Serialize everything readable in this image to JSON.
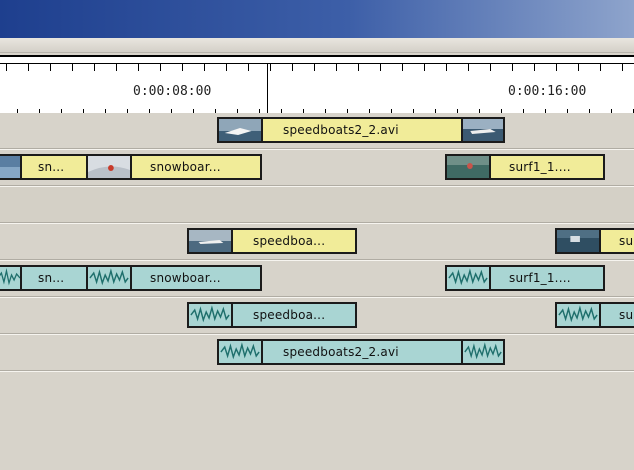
{
  "timeline": {
    "timecodes": [
      "0:00:08:00",
      "0:00:16:00"
    ]
  },
  "tracks": {
    "v3": {
      "clip1": "speedboats2_2.avi"
    },
    "v2": {
      "clip1": "sn...",
      "clip2": "snowboar...",
      "clip3": "surf1_1...."
    },
    "v1": {
      "clip1": "speedboa...",
      "clip2": "su"
    },
    "a1": {
      "clip1": "sn...",
      "clip2": "snowboar...",
      "clip3": "surf1_1...."
    },
    "a2": {
      "clip1": "speedboa...",
      "clip2": "su"
    },
    "a3": {
      "clip1": "speedboats2_2.avi"
    }
  },
  "colors": {
    "video_clip": "#f1ec99",
    "audio_clip": "#a9d5d3",
    "titlebar": "#1e3f8e"
  },
  "icons": {
    "video_thumbnail": "video-thumbnail-icon",
    "audio_waveform": "waveform-icon"
  }
}
